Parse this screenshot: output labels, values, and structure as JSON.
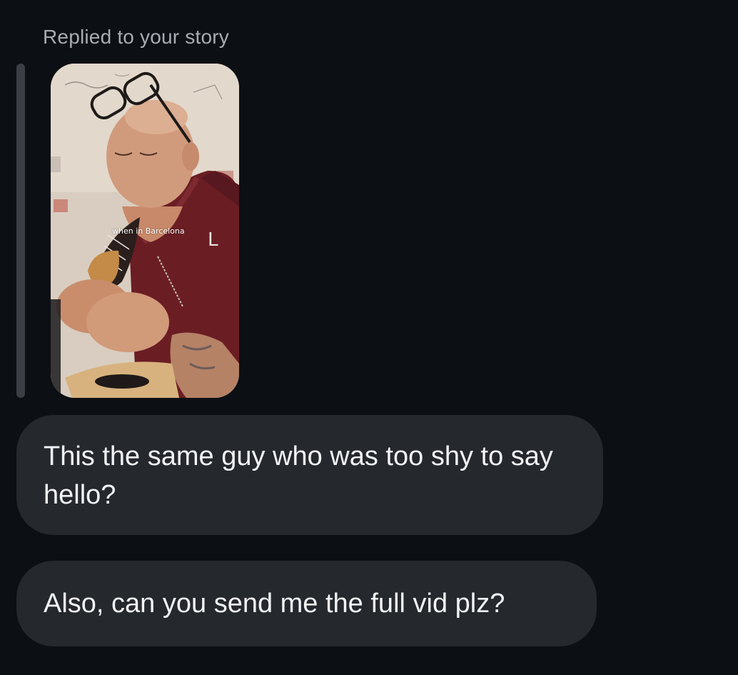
{
  "thread": {
    "reply_label": "Replied to your story",
    "story": {
      "caption": "when in Barcelona",
      "jacket_letter": "L"
    },
    "messages": [
      {
        "text": "This the same guy who was too shy to say hello?"
      },
      {
        "text": "Also, can you send me the full vid plz?"
      }
    ]
  },
  "colors": {
    "background": "#0c0f14",
    "bubble": "#25282d",
    "bubble_text": "#f2f3f5",
    "muted_text": "#a8acb3",
    "quote_bar": "#3a3e45"
  }
}
